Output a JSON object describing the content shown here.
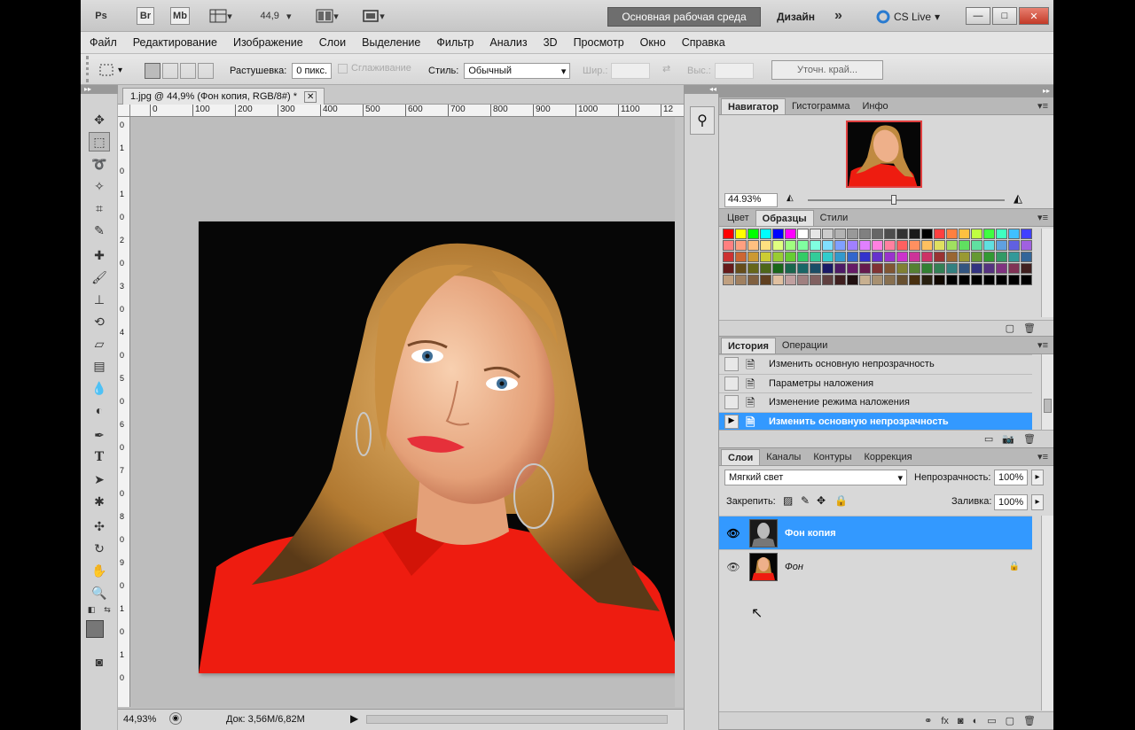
{
  "titlebar": {
    "ps_logo": "Ps",
    "br_label": "Br",
    "mb_label": "Mb",
    "zoom_value": "44,9",
    "workspace_button": "Основная рабочая среда",
    "design_label": "Дизайн",
    "more_label": "»",
    "cs_live_label": "CS Live",
    "min_label": "—",
    "max_label": "□",
    "close_label": "✕"
  },
  "menu": [
    "Файл",
    "Редактирование",
    "Изображение",
    "Слои",
    "Выделение",
    "Фильтр",
    "Анализ",
    "3D",
    "Просмотр",
    "Окно",
    "Справка"
  ],
  "options": {
    "feather_label": "Растушевка:",
    "feather_value": "0 пикс.",
    "antialias_label": "Сглаживание",
    "style_label": "Стиль:",
    "style_value": "Обычный",
    "width_label": "Шир.:",
    "height_label": "Выс.:",
    "refine_edge_label": "Уточн. край..."
  },
  "document": {
    "tab_title": "1.jpg @ 44,9% (Фон копия, RGB/8#) *",
    "close_label": "✕",
    "ruler_h": [
      "0",
      "100",
      "200",
      "300",
      "400",
      "500",
      "600",
      "700",
      "800",
      "900",
      "1000",
      "1100",
      "12"
    ],
    "ruler_v": [
      "0",
      "1",
      "0",
      "1",
      "0",
      "2",
      "0",
      "3",
      "0",
      "4",
      "0",
      "5",
      "0",
      "6",
      "0",
      "7",
      "0",
      "8",
      "0",
      "9",
      "0",
      "1",
      "0",
      "1",
      "0"
    ],
    "status_zoom": "44,93%",
    "status_doc": "Док: 3,56M/6,82M"
  },
  "navigator": {
    "tabs": [
      "Навигатор",
      "Гистограмма",
      "Инфо"
    ],
    "zoom_value": "44.93%"
  },
  "swatches": {
    "tabs": [
      "Цвет",
      "Образцы",
      "Стили"
    ],
    "colors": [
      "#ff0000",
      "#ffff00",
      "#00ff00",
      "#00ffff",
      "#0000ff",
      "#ff00ff",
      "#ffffff",
      "#e6e6e6",
      "#cccccc",
      "#b3b3b3",
      "#999999",
      "#808080",
      "#666666",
      "#4d4d4d",
      "#333333",
      "#1a1a1a",
      "#000000",
      "#ff4040",
      "#ff8040",
      "#ffc040",
      "#c0ff40",
      "#40ff40",
      "#40ffc0",
      "#40c0ff",
      "#4040ff",
      "#ff8080",
      "#ffa080",
      "#ffc080",
      "#ffe080",
      "#e0ff80",
      "#a0ff80",
      "#80ffa0",
      "#80ffe0",
      "#80e0ff",
      "#80a0ff",
      "#a080ff",
      "#e080ff",
      "#ff80e0",
      "#ff80a0",
      "#ff6060",
      "#ff9060",
      "#ffc060",
      "#e0e060",
      "#a0e060",
      "#60e060",
      "#60e0a0",
      "#60e0e0",
      "#60a0e0",
      "#6060e0",
      "#a060e0",
      "#cc3333",
      "#cc6633",
      "#cc9933",
      "#cccc33",
      "#99cc33",
      "#66cc33",
      "#33cc66",
      "#33cc99",
      "#33cccc",
      "#3399cc",
      "#3366cc",
      "#3333cc",
      "#6633cc",
      "#9933cc",
      "#cc33cc",
      "#cc3399",
      "#cc3366",
      "#993333",
      "#996633",
      "#999933",
      "#669933",
      "#339933",
      "#339966",
      "#339999",
      "#336699",
      "#661a1a",
      "#664d1a",
      "#66661a",
      "#4d661a",
      "#1a661a",
      "#1a664d",
      "#1a6666",
      "#1a4d66",
      "#1a1a66",
      "#4d1a66",
      "#661a66",
      "#661a4d",
      "#803333",
      "#805533",
      "#808033",
      "#558033",
      "#338033",
      "#338055",
      "#338080",
      "#335580",
      "#333380",
      "#553380",
      "#803380",
      "#803355",
      "#402020",
      "#c0a080",
      "#a08060",
      "#806040",
      "#604020",
      "#e0c0a0",
      "#c0a0a0",
      "#a08080",
      "#806060",
      "#604040",
      "#402020",
      "#201010",
      "#c8b090",
      "#a89070",
      "#887050",
      "#685030",
      "#483010",
      "#282010",
      "#100800",
      "#000000",
      "#000000",
      "#000000",
      "#000000",
      "#000000",
      "#000000",
      "#000000"
    ]
  },
  "history": {
    "tabs": [
      "История",
      "Операции"
    ],
    "items": [
      {
        "label": "Изменить основную непрозрачность",
        "selected": false
      },
      {
        "label": "Параметры наложения",
        "selected": false
      },
      {
        "label": "Изменение режима наложения",
        "selected": false
      },
      {
        "label": "Изменить основную непрозрачность",
        "selected": true
      }
    ]
  },
  "layers": {
    "tabs": [
      "Слои",
      "Каналы",
      "Контуры",
      "Коррекция"
    ],
    "blend_mode": "Мягкий свет",
    "opacity_label": "Непрозрачность:",
    "opacity_value": "100%",
    "lock_label": "Закрепить:",
    "fill_label": "Заливка:",
    "fill_value": "100%",
    "items": [
      {
        "name": "Фон копия",
        "selected": true,
        "locked": false
      },
      {
        "name": "Фон",
        "selected": false,
        "locked": true
      }
    ]
  },
  "colors": {
    "selection_blue": "#3399ff",
    "workspace_gray": "#bdbdbd",
    "photo_bg": "#060606"
  }
}
